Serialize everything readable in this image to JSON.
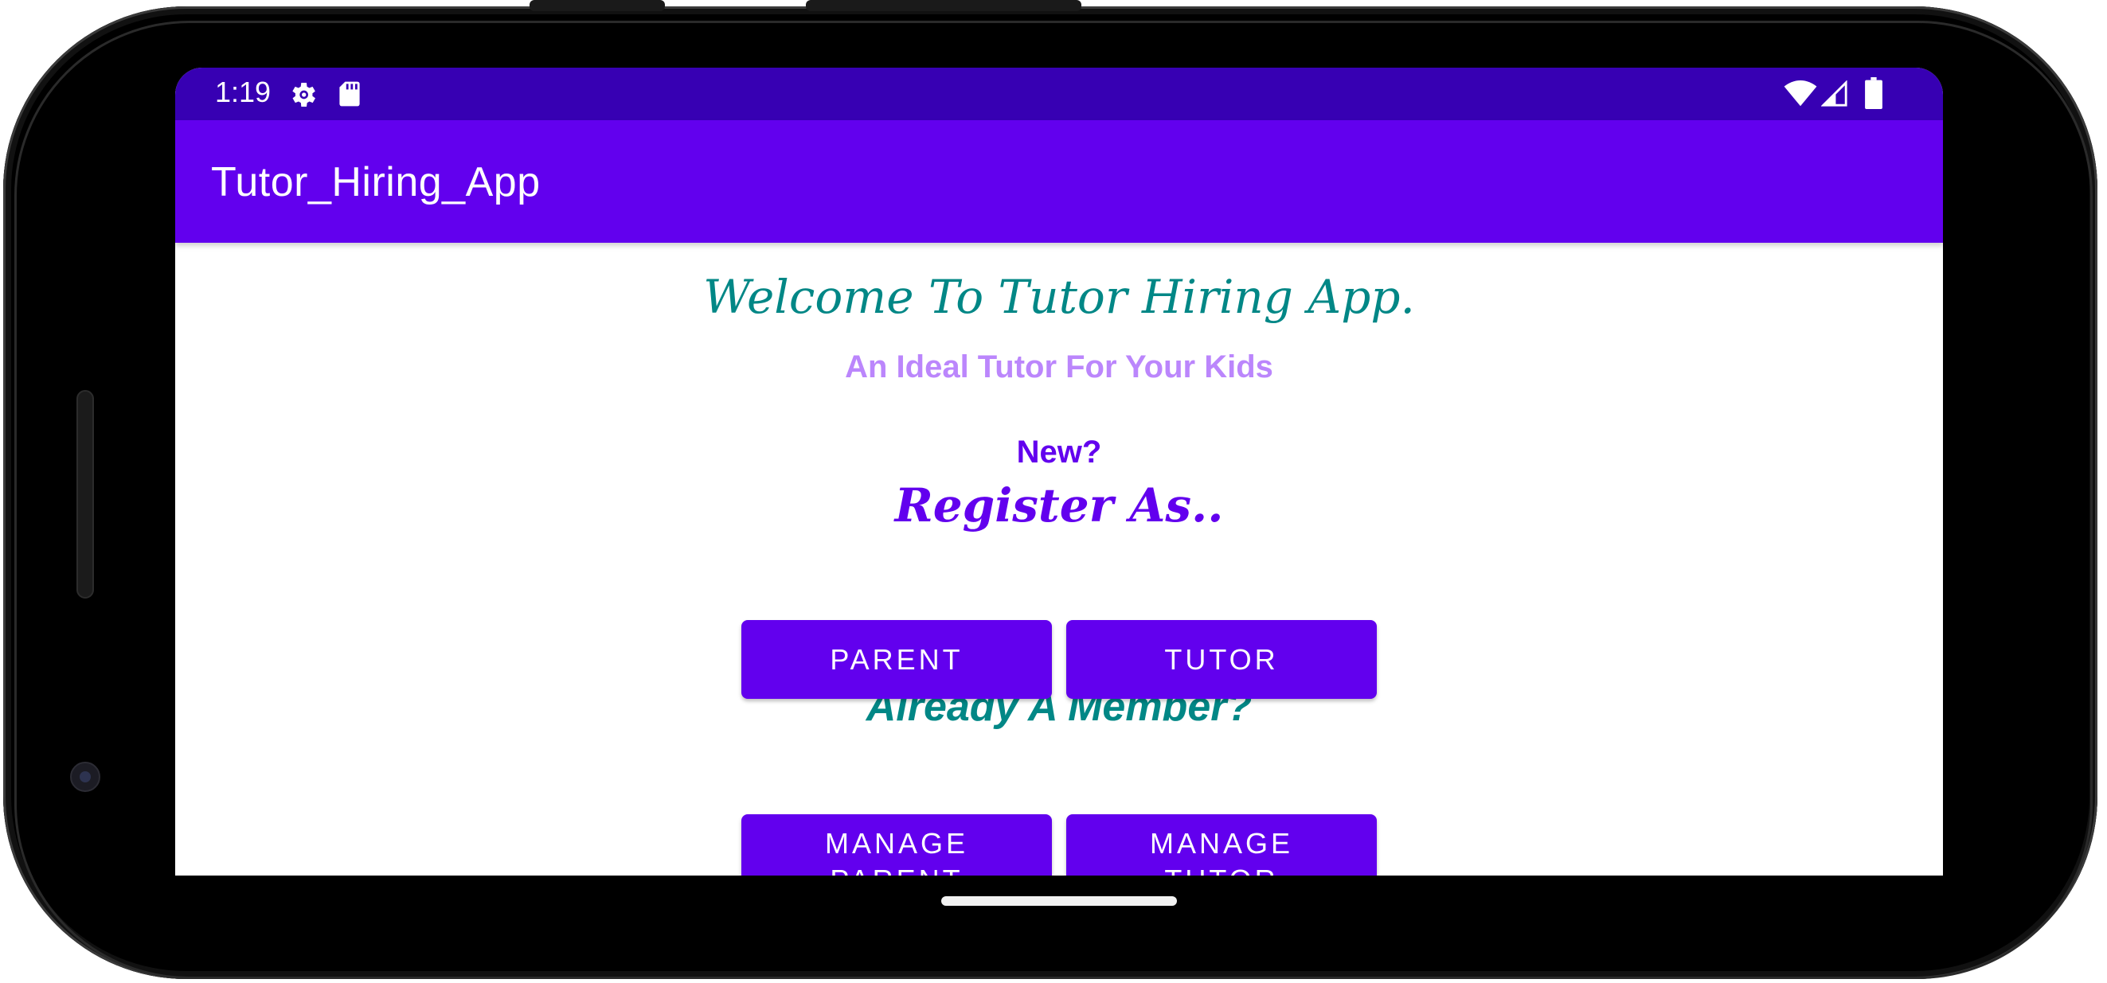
{
  "status_bar": {
    "time": "1:19",
    "icons": [
      "gear-icon",
      "sd-card-icon",
      "wifi-icon",
      "signal-icon",
      "battery-icon"
    ]
  },
  "app_bar": {
    "title": "Tutor_Hiring_App"
  },
  "main": {
    "welcome": "Welcome To Tutor Hiring App.",
    "tagline": "An Ideal Tutor For Your Kids",
    "new_label": "New?",
    "register_label": "Register As..",
    "register_buttons": {
      "parent": "PARENT",
      "tutor": "TUTOR"
    },
    "member_label": "Already A Member?",
    "manage_buttons": {
      "parent_line1": "MANAGE",
      "parent_line2": "PARENT",
      "tutor_line1": "MANAGE",
      "tutor_line2": "TUTOR"
    }
  },
  "colors": {
    "status_bar": "#3700b3",
    "primary": "#6200ee",
    "teal": "#018786",
    "light_purple": "#bb86fc"
  }
}
